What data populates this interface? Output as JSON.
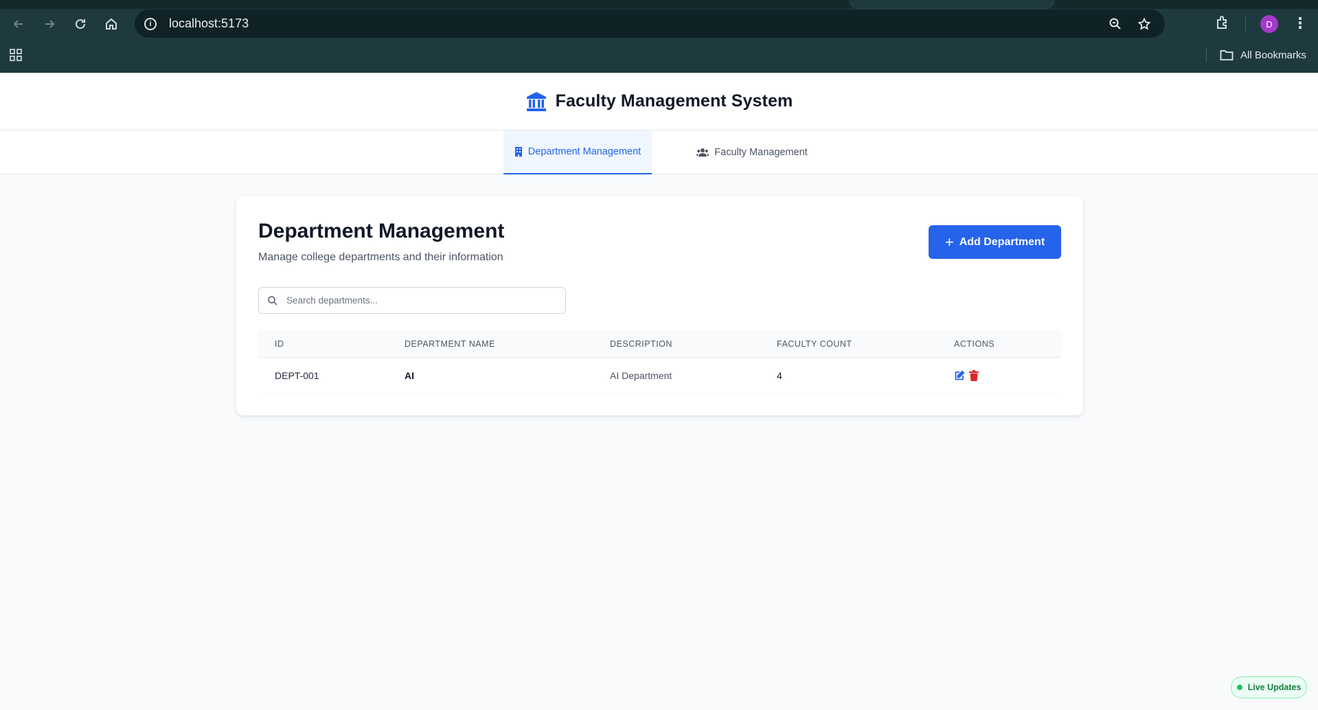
{
  "browser": {
    "url": "localhost:5173",
    "bookmarks_label": "All Bookmarks",
    "avatar_initial": "D"
  },
  "app": {
    "title": "Faculty Management System",
    "logo_icon": "university-icon",
    "accent_color": "#2563eb"
  },
  "tabs": [
    {
      "label": "Department Management",
      "icon": "building-icon",
      "active": true
    },
    {
      "label": "Faculty Management",
      "icon": "users-icon",
      "active": false
    }
  ],
  "page": {
    "title": "Department Management",
    "subtitle": "Manage college departments and their information",
    "add_button_label": "Add Department",
    "search_placeholder": "Search departments..."
  },
  "table": {
    "headers": [
      "ID",
      "DEPARTMENT NAME",
      "DESCRIPTION",
      "FACULTY COUNT",
      "ACTIONS"
    ],
    "rows": [
      {
        "id": "DEPT-001",
        "name": "AI",
        "description": "AI Department",
        "faculty_count": "4"
      }
    ]
  },
  "status": {
    "live_label": "Live Updates"
  }
}
